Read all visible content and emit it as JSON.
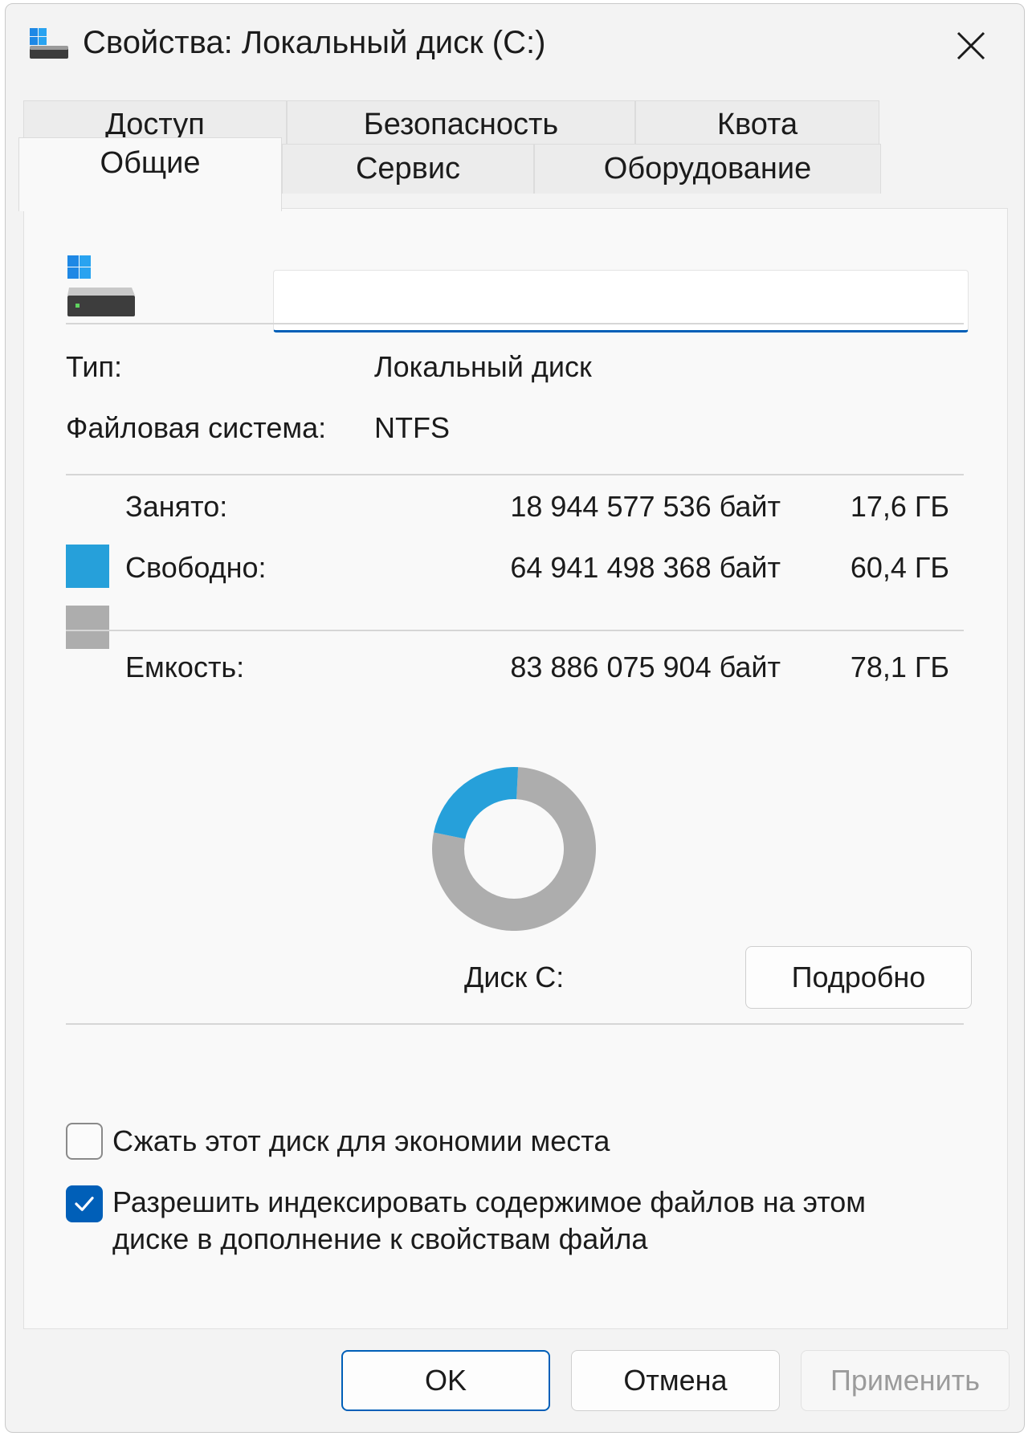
{
  "window": {
    "title": "Свойства: Локальный диск (С:)"
  },
  "tabs": {
    "row1": [
      "Доступ",
      "Безопасность",
      "Квота"
    ],
    "row2": [
      "Общие",
      "Сервис",
      "Оборудование"
    ],
    "active": "Общие"
  },
  "general": {
    "name_value": "",
    "type_label": "Тип:",
    "type_value": "Локальный диск",
    "fs_label": "Файловая система:",
    "fs_value": "NTFS",
    "used": {
      "label": "Занято:",
      "bytes": "18 944 577 536 байт",
      "size": "17,6 ГБ",
      "color": "#26a0da"
    },
    "free": {
      "label": "Свободно:",
      "bytes": "64 941 498 368 байт",
      "size": "60,4 ГБ",
      "color": "#adadad"
    },
    "capacity": {
      "label": "Емкость:",
      "bytes": "83 886 075 904 байт",
      "size": "78,1 ГБ"
    },
    "used_fraction": 0.2258,
    "disk_label": "Диск С:",
    "details_button": "Подробно",
    "compress": {
      "label": "Сжать этот диск для экономии места",
      "checked": false
    },
    "index": {
      "label_line1": "Разрешить индексировать содержимое файлов на этом",
      "label_line2": "диске в дополнение к свойствам файла",
      "checked": true
    }
  },
  "footer": {
    "ok": "OK",
    "cancel": "Отмена",
    "apply": "Применить"
  },
  "colors": {
    "accent": "#005fb8"
  }
}
